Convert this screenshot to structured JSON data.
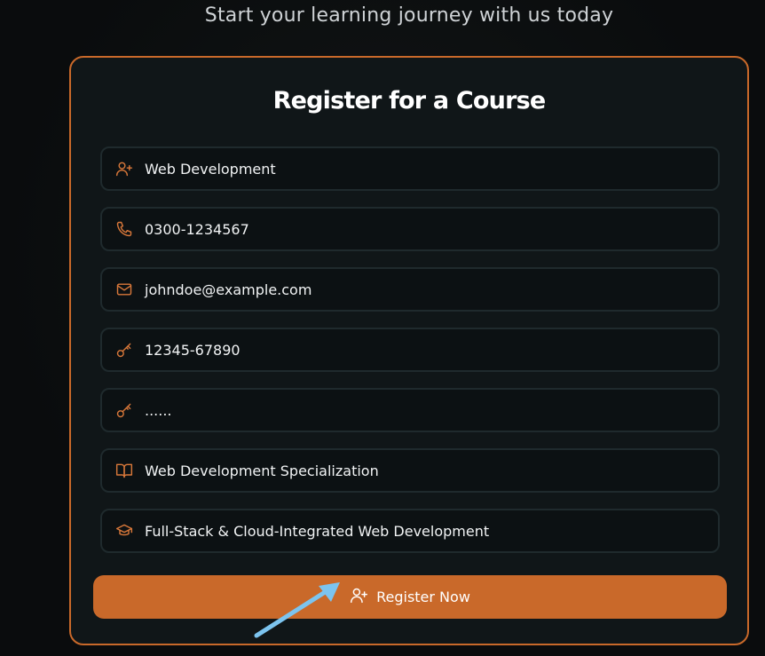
{
  "header": {
    "subtitle": "Start your learning journey with us today"
  },
  "form": {
    "title": "Register for a Course",
    "fields": [
      {
        "icon": "user-plus-icon",
        "value": "Web Development"
      },
      {
        "icon": "phone-icon",
        "value": "0300-1234567"
      },
      {
        "icon": "mail-icon",
        "value": "johndoe@example.com"
      },
      {
        "icon": "key-icon",
        "value": "12345-67890"
      },
      {
        "icon": "key-icon",
        "value": "......"
      },
      {
        "icon": "book-open-icon",
        "value": "Web Development Specialization"
      },
      {
        "icon": "graduation-cap-icon",
        "value": "Full-Stack & Cloud-Integrated Web Development"
      }
    ],
    "submit": {
      "icon": "user-plus-icon",
      "label": "Register Now"
    }
  },
  "annotation": {
    "arrow_color": "#7cc4ef"
  },
  "colors": {
    "accent": "#c9692a",
    "background": "#0a0c0d",
    "card": "#101618",
    "field_border": "#1f2a2d"
  }
}
